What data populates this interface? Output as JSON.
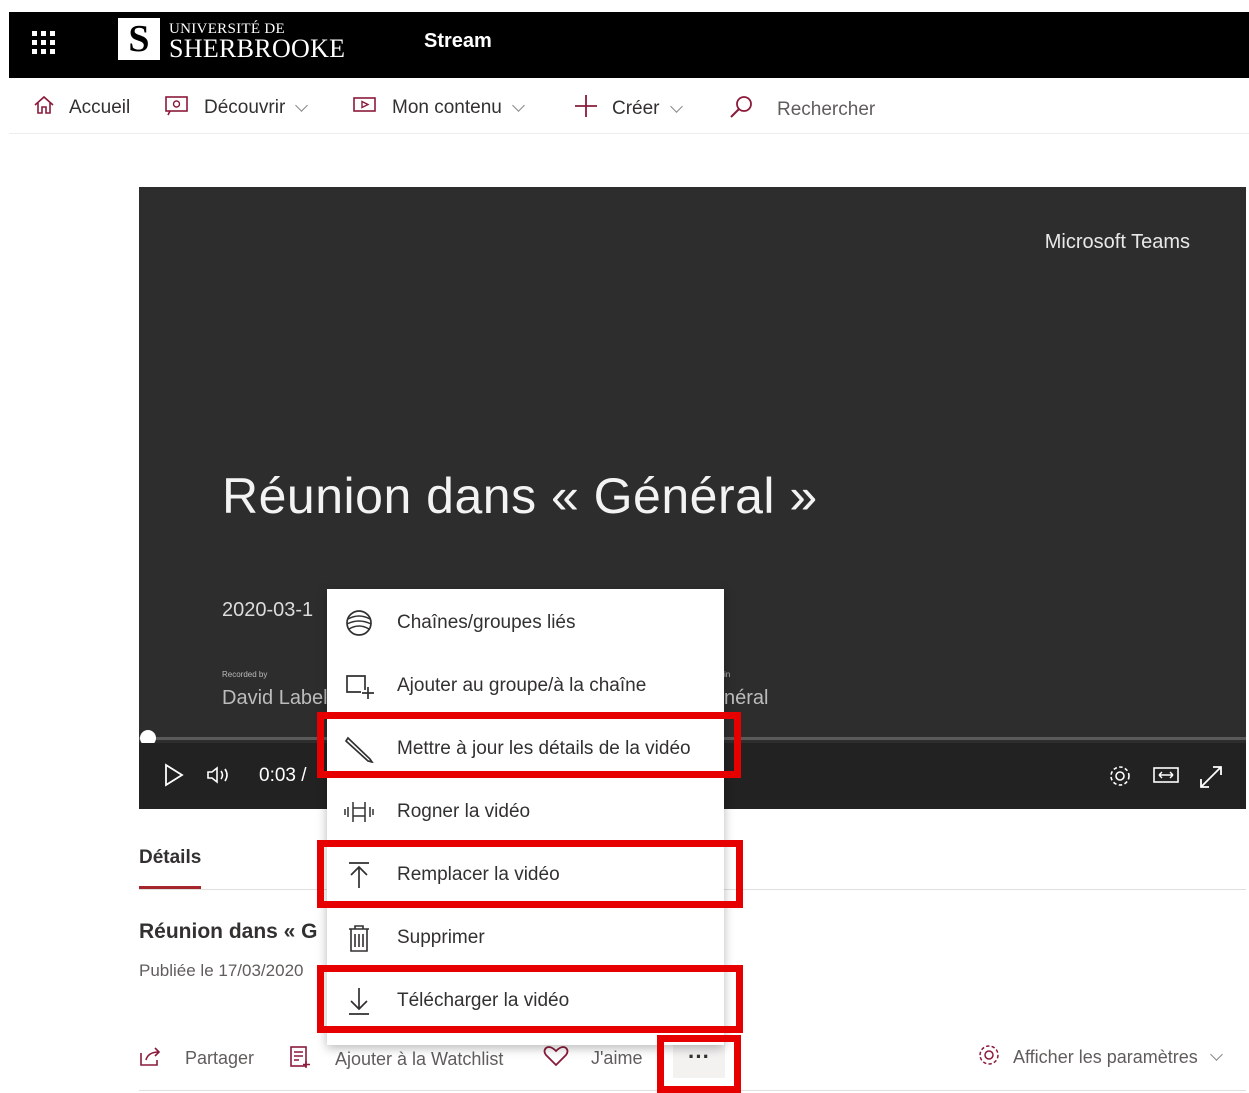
{
  "header": {
    "logo_letter": "S",
    "logo_line1": "UNIVERSITÉ DE",
    "logo_line2": "SHERBROOKE",
    "app_title": "Stream"
  },
  "nav": {
    "home": "Accueil",
    "discover": "Découvrir",
    "my_content": "Mon contenu",
    "create": "Créer",
    "search": "Rechercher"
  },
  "video": {
    "brand": "Microsoft Teams",
    "title": "Réunion dans «  Général  »",
    "date": "2020-03-1",
    "recorded_label": "Recorded by",
    "recorded_by": "David Label",
    "channel_label": "in",
    "channel": "néral",
    "time": "0:03  /"
  },
  "details": {
    "tab": "Détails",
    "title": "Réunion dans «  G",
    "published": "Publiée le 17/03/2020"
  },
  "actions": {
    "share": "Partager",
    "watchlist": "Ajouter à la Watchlist",
    "like": "J'aime",
    "more": "···",
    "settings": "Afficher les paramètres"
  },
  "menu": {
    "items": [
      {
        "label": "Chaînes/groupes liés",
        "icon": "channels-icon"
      },
      {
        "label": "Ajouter au groupe/à la chaîne",
        "icon": "add-to-group-icon"
      },
      {
        "label": "Mettre à jour les détails de la vidéo",
        "icon": "pencil-icon"
      },
      {
        "label": "Rogner la vidéo",
        "icon": "trim-icon"
      },
      {
        "label": "Remplacer la vidéo",
        "icon": "upload-icon"
      },
      {
        "label": "Supprimer",
        "icon": "trash-icon"
      },
      {
        "label": "Télécharger la vidéo",
        "icon": "download-icon"
      }
    ]
  },
  "colors": {
    "highlight": "#e60000",
    "accent": "#a4262c",
    "topbar": "#000000",
    "player_bg": "#2d2d2d"
  }
}
